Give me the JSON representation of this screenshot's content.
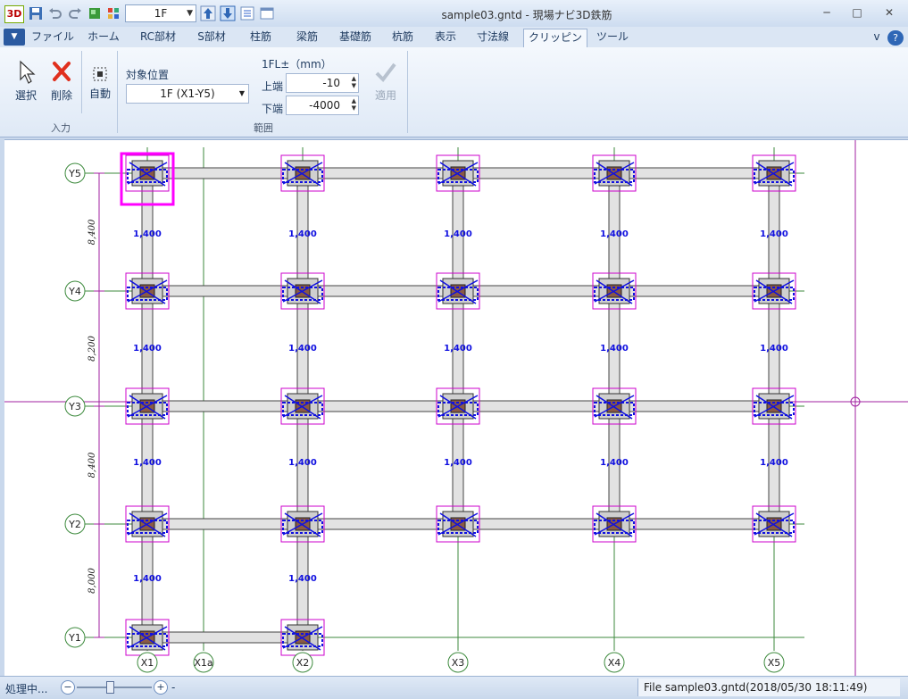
{
  "window": {
    "title": "sample03.gntd - 現場ナビ3D鉄筋",
    "app_icon_text": "3D",
    "floor_value": "1F",
    "controls": {
      "minimize": "─",
      "maximize": "□",
      "close": "✕"
    }
  },
  "tabs": [
    {
      "label": "ファイル"
    },
    {
      "label": "ホーム"
    },
    {
      "label": "RC部材"
    },
    {
      "label": "S部材"
    },
    {
      "label": "柱筋"
    },
    {
      "label": "梁筋"
    },
    {
      "label": "基礎筋"
    },
    {
      "label": "杭筋"
    },
    {
      "label": "表示"
    },
    {
      "label": "寸法線"
    },
    {
      "label": "クリッピング"
    },
    {
      "label": "ツール"
    }
  ],
  "tabs_right": {
    "collapse": "v",
    "help": "?"
  },
  "ribbon": {
    "input_group": {
      "label": "入力",
      "select": "選択",
      "delete": "削除",
      "auto": "自動"
    },
    "target": {
      "label": "対象位置",
      "value": "1F (X1-Y5)"
    },
    "range": {
      "label": "範囲",
      "header": "1FL±（mm）",
      "upper_label": "上端",
      "upper_value": "-10",
      "lower_label": "下端",
      "lower_value": "-4000",
      "apply": "適用"
    }
  },
  "plan": {
    "x_axes": [
      "X1",
      "X1a",
      "X2",
      "X3",
      "X4",
      "X5"
    ],
    "y_axes": [
      "Y5",
      "Y4",
      "Y3",
      "Y2",
      "Y1"
    ],
    "y_dims": [
      "8,400",
      "8,200",
      "8,400",
      "8,000"
    ],
    "rebar_mark": "1,400",
    "colors": {
      "grid": "#3d8a3d",
      "rebar": "#1010e0",
      "clip": "#cc00cc",
      "selection": "#ff00ff"
    }
  },
  "status": {
    "processing": "処理中...",
    "zoom_minus": "−",
    "zoom_plus": "+",
    "zoom_dash": "-",
    "file": "File sample03.gntd(2018/05/30 18:11:49)"
  }
}
